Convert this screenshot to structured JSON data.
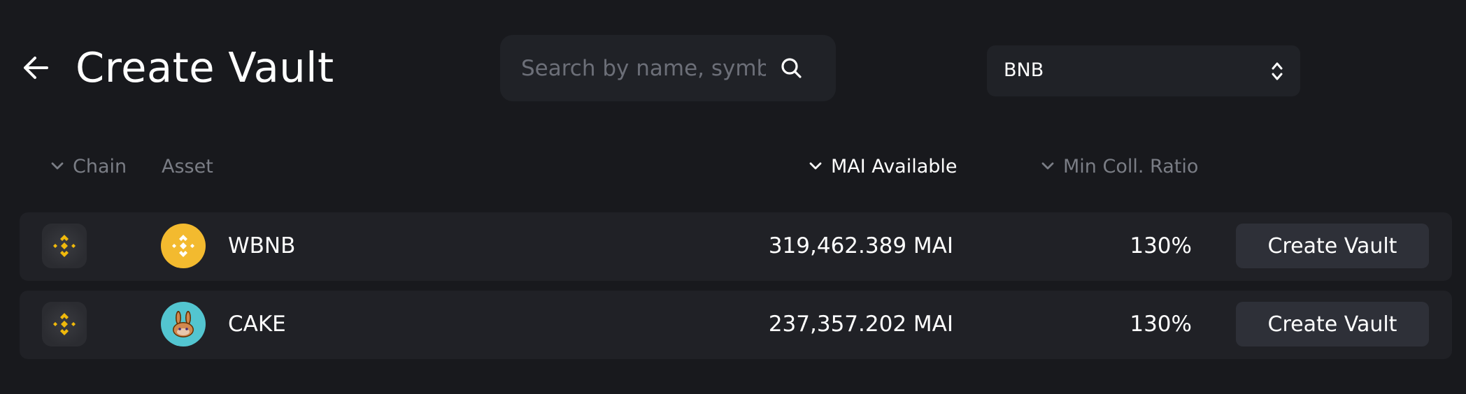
{
  "header": {
    "title": "Create Vault",
    "back_icon": "arrow-left-icon"
  },
  "search": {
    "placeholder": "Search by name, symbol",
    "value": "",
    "icon": "search-icon"
  },
  "chain_select": {
    "value": "BNB",
    "icon": "chevron-up-down-icon"
  },
  "columns": {
    "chain": "Chain",
    "asset": "Asset",
    "mai_available": "MAI Available",
    "min_coll_ratio": "Min Coll. Ratio"
  },
  "rows": [
    {
      "chain_icon": "bnb-chain-icon",
      "asset_icon": "wbnb-token-icon",
      "asset": "WBNB",
      "mai_available": "319,462.389 MAI",
      "min_coll_ratio": "130%",
      "action": "Create Vault"
    },
    {
      "chain_icon": "bnb-chain-icon",
      "asset_icon": "cake-token-icon",
      "asset": "CAKE",
      "mai_available": "237,357.202 MAI",
      "min_coll_ratio": "130%",
      "action": "Create Vault"
    }
  ],
  "colors": {
    "background": "#18191d",
    "row_background": "#202126",
    "button_background": "#2e3038",
    "bnb_yellow": "#f0b90b",
    "wbnb_gold": "#f3ba2f",
    "cake_teal": "#53c5d0",
    "muted_text": "#7a7d85"
  }
}
